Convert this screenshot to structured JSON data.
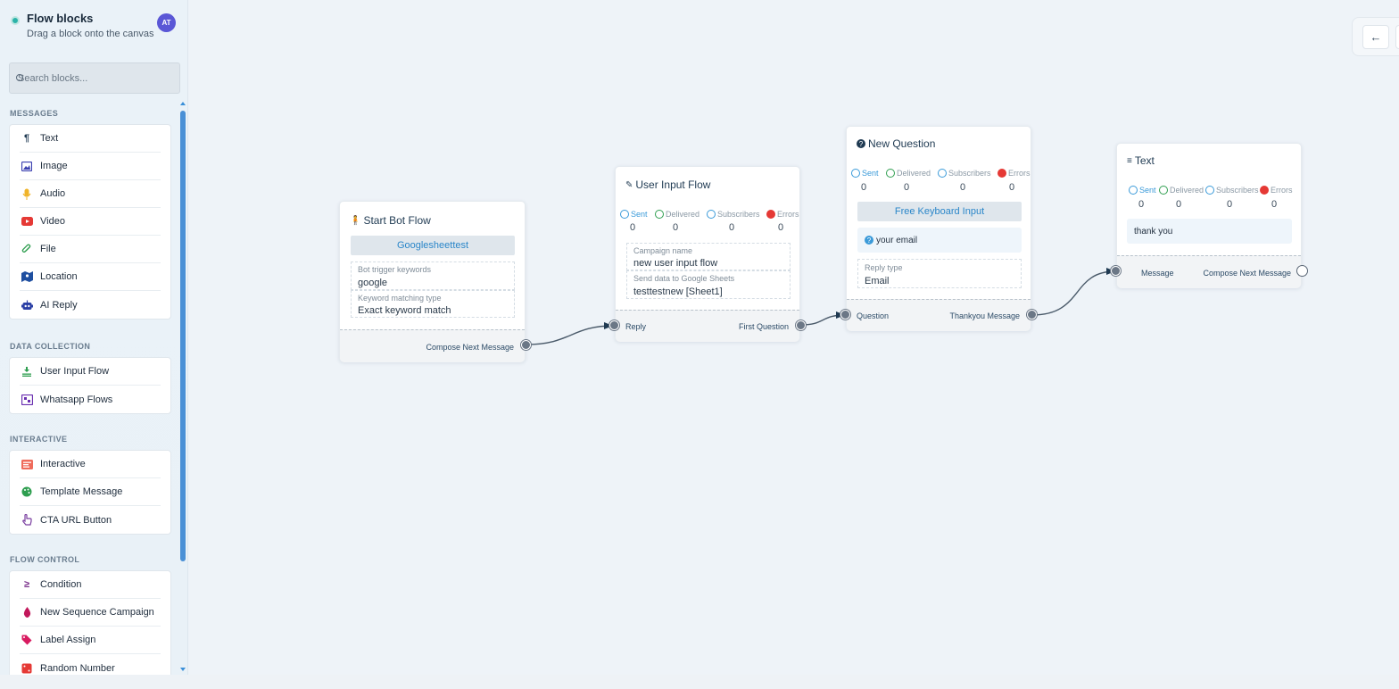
{
  "sidebar": {
    "title": "Flow blocks",
    "subtitle": "Drag a block onto the canvas",
    "avatar": "AT",
    "search_placeholder": "Search blocks...",
    "sections": {
      "messages": {
        "label": "MESSAGES",
        "items": [
          {
            "label": "Text",
            "icon": "paragraph-icon"
          },
          {
            "label": "Image",
            "icon": "image-icon"
          },
          {
            "label": "Audio",
            "icon": "microphone-icon"
          },
          {
            "label": "Video",
            "icon": "video-icon"
          },
          {
            "label": "File",
            "icon": "paperclip-icon"
          },
          {
            "label": "Location",
            "icon": "map-icon"
          },
          {
            "label": "AI Reply",
            "icon": "robot-icon"
          }
        ]
      },
      "data_collection": {
        "label": "DATA COLLECTION",
        "items": [
          {
            "label": "User Input Flow",
            "icon": "user-input-icon"
          },
          {
            "label": "Whatsapp Flows",
            "icon": "flows-icon"
          }
        ]
      },
      "interactive": {
        "label": "INTERACTIVE",
        "items": [
          {
            "label": "Interactive",
            "icon": "interactive-icon"
          },
          {
            "label": "Template Message",
            "icon": "palette-icon"
          },
          {
            "label": "CTA URL Button",
            "icon": "pointer-icon"
          }
        ]
      },
      "flow_control": {
        "label": "FLOW CONTROL",
        "items": [
          {
            "label": "Condition",
            "icon": "condition-icon"
          },
          {
            "label": "New Sequence Campaign",
            "icon": "drop-icon"
          },
          {
            "label": "Label Assign",
            "icon": "tag-icon"
          },
          {
            "label": "Random Number",
            "icon": "dice-icon"
          }
        ]
      }
    }
  },
  "canvas": {
    "nodes": {
      "start": {
        "title": "Start Bot Flow",
        "pill": "Googlesheettest",
        "fields": [
          {
            "label": "Bot trigger keywords",
            "value": "google"
          },
          {
            "label": "Keyword matching type",
            "value": "Exact keyword match"
          }
        ],
        "out_label": "Compose Next Message"
      },
      "user_input": {
        "title": "User Input Flow",
        "stats": {
          "sent_label": "Sent",
          "delivered_label": "Delivered",
          "subscribers_label": "Subscribers",
          "errors_label": "Errors",
          "sent": "0",
          "delivered": "0",
          "subscribers": "0",
          "errors": "0"
        },
        "fields": [
          {
            "label": "Campaign name",
            "value": "new user input flow"
          },
          {
            "label": "Send data to Google Sheets",
            "value": "testtestnew [Sheet1]"
          }
        ],
        "in_label": "Reply",
        "out_label": "First Question"
      },
      "question": {
        "title": "New Question",
        "stats": {
          "sent_label": "Sent",
          "delivered_label": "Delivered",
          "subscribers_label": "Subscribers",
          "errors_label": "Errors",
          "sent": "0",
          "delivered": "0",
          "subscribers": "0",
          "errors": "0"
        },
        "pill": "Free Keyboard Input",
        "message": "your email",
        "field": {
          "label": "Reply type",
          "value": "Email"
        },
        "in_label": "Question",
        "out_label": "Thankyou Message"
      },
      "text": {
        "title": "Text",
        "stats": {
          "sent_label": "Sent",
          "delivered_label": "Delivered",
          "subscribers_label": "Subscribers",
          "errors_label": "Errors",
          "sent": "0",
          "delivered": "0",
          "subscribers": "0",
          "errors": "0"
        },
        "message": "thank you",
        "in_label": "Message",
        "out_label": "Compose Next Message"
      }
    }
  },
  "colors": {
    "accent": "#2a86c9",
    "port": "#6b7786",
    "wire": "#4a5a6a",
    "scrollbar": "#4a90d6"
  }
}
